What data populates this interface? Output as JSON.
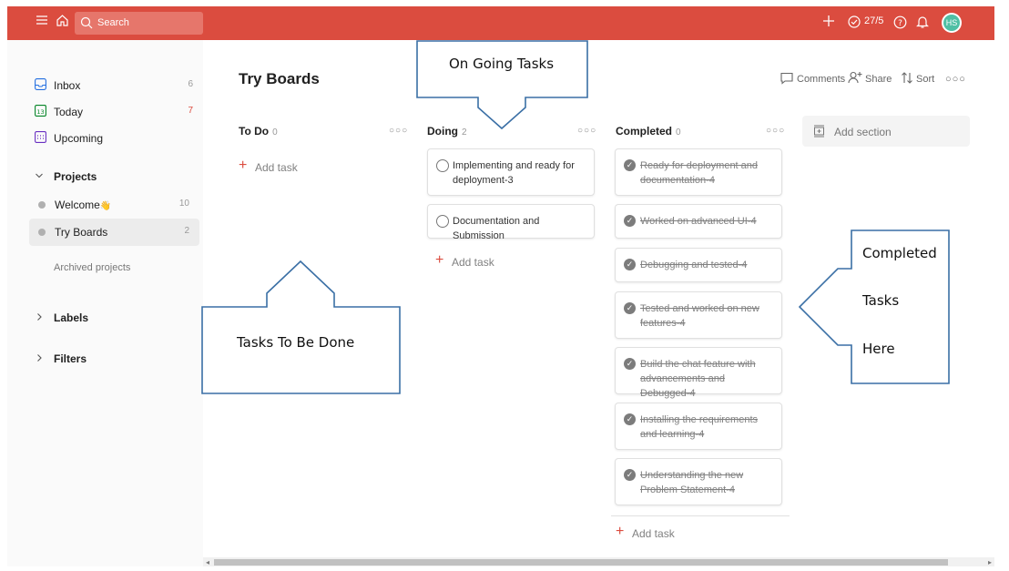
{
  "topbar": {
    "search_placeholder": "Search",
    "karma": "27/5",
    "avatar_initials": "HS",
    "brand_color": "#db4c3f"
  },
  "sidebar": {
    "nav": [
      {
        "label": "Inbox",
        "count": "6",
        "icon": "inbox-icon"
      },
      {
        "label": "Today",
        "count": "7",
        "icon": "calendar-today-icon"
      },
      {
        "label": "Upcoming",
        "count": "",
        "icon": "calendar-upcoming-icon"
      }
    ],
    "projects_label": "Projects",
    "projects": [
      {
        "label": "Welcome",
        "emoji": "👋",
        "count": "10"
      },
      {
        "label": "Try Boards",
        "count": "2"
      }
    ],
    "archived_label": "Archived projects",
    "labels_label": "Labels",
    "filters_label": "Filters"
  },
  "main": {
    "title": "Try Boards",
    "actions": {
      "comments": "Comments",
      "share": "Share",
      "sort": "Sort"
    },
    "add_task": "Add task",
    "add_section": "Add section",
    "columns": [
      {
        "name": "To Do",
        "count": "0",
        "tasks": []
      },
      {
        "name": "Doing",
        "count": "2",
        "tasks": [
          "Implementing and ready for deployment-3",
          "Documentation and Submission"
        ]
      },
      {
        "name": "Completed",
        "count": "0",
        "tasks": [
          "Ready for deployment and documentation-4",
          "Worked on advanced UI-4",
          "Debugging and tested-4",
          "Tested and worked on new features-4",
          "Build the chat feature with advancements and Debugged-4",
          "Installing the requirements and learning-4",
          "Understanding the new Problem Statement-4"
        ]
      }
    ]
  },
  "annotations": {
    "ongoing": "On Going Tasks",
    "todo": "Tasks To Be Done",
    "completed_1": "Completed",
    "completed_2": "Tasks",
    "completed_3": "Here"
  }
}
